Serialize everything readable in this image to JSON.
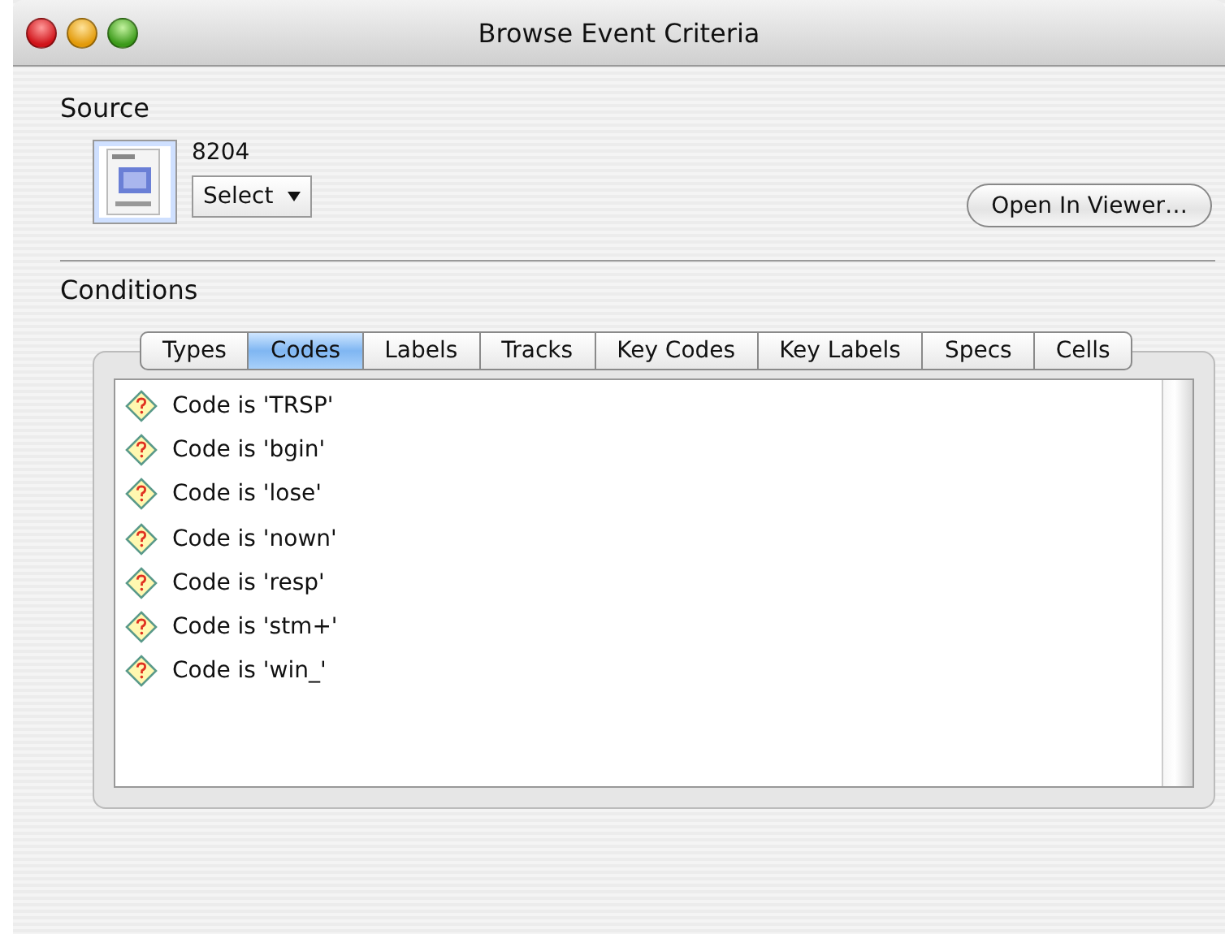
{
  "window": {
    "title": "Browse Event Criteria"
  },
  "source": {
    "heading": "Source",
    "name": "8204",
    "select": {
      "value": "Select"
    },
    "open_button": "Open In Viewer…"
  },
  "conditions": {
    "heading": "Conditions",
    "tabs": [
      {
        "label": "Types",
        "selected": false
      },
      {
        "label": "Codes",
        "selected": true
      },
      {
        "label": "Labels",
        "selected": false
      },
      {
        "label": "Tracks",
        "selected": false
      },
      {
        "label": "Key Codes",
        "selected": false
      },
      {
        "label": "Key Labels",
        "selected": false
      },
      {
        "label": "Specs",
        "selected": false
      },
      {
        "label": "Cells",
        "selected": false
      }
    ],
    "items": [
      "Code is 'TRSP'",
      "Code is 'bgin'",
      "Code is 'lose'",
      "Code is 'nown'",
      "Code is 'resp'",
      "Code is 'stm+'",
      "Code is 'win_'"
    ]
  }
}
